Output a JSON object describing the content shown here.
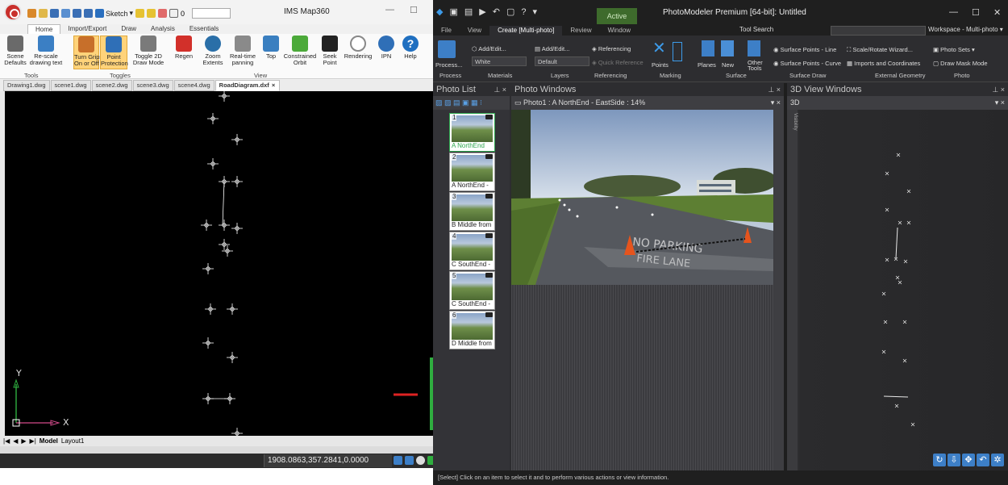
{
  "ims": {
    "title": "IMS Map360",
    "quick_access": {
      "workspace_label": "Sketch",
      "layer_value": "0"
    },
    "ribbon_tabs": [
      "Home",
      "Import/Export",
      "Draw",
      "Analysis",
      "Essentials"
    ],
    "active_tab": "Home",
    "ribbon_buttons": [
      {
        "label": "Scene\nDefaults",
        "group": "Tools"
      },
      {
        "label": "Re-scale\ndrawing text",
        "group": "Tools"
      },
      {
        "label": "Turn Grips\nOn or Off",
        "group": "Toggles",
        "highlighted": true
      },
      {
        "label": "Point\nProtection",
        "group": "Toggles",
        "highlighted": true
      },
      {
        "label": "Toggle 2D\nDraw Mode",
        "group": "Toggles"
      },
      {
        "label": "Regen",
        "group": "View"
      },
      {
        "label": "Zoom\nExtents",
        "group": "View"
      },
      {
        "label": "Real-time\npanning",
        "group": "View"
      },
      {
        "label": "Top",
        "group": "View"
      },
      {
        "label": "Constrained\nOrbit",
        "group": "View"
      },
      {
        "label": "Seek\nPoint",
        "group": "View"
      },
      {
        "label": "Rendering",
        "group": ""
      },
      {
        "label": "IPN",
        "group": ""
      },
      {
        "label": "Help",
        "group": ""
      }
    ],
    "ribbon_groups": [
      "Tools",
      "Toggles",
      "View"
    ],
    "doc_tabs": [
      "Drawing1.dwg",
      "scene1.dwg",
      "scene2.dwg",
      "scene3.dwg",
      "scene4.dwg",
      "RoadDiagram.dxf"
    ],
    "active_doc": "RoadDiagram.dxf",
    "layout_tabs": [
      "Model",
      "Layout1"
    ],
    "coordinates": "1908.0863,357.2841,0.0000",
    "axis_labels": {
      "y": "Y",
      "x": "X"
    },
    "colors": {
      "canvas": "#000000",
      "accent": "#c9302c",
      "axis": "#2fae3f"
    }
  },
  "pm": {
    "title": "PhotoModeler Premium [64-bit]: Untitled",
    "active_badge": "Active",
    "tabs": [
      "File",
      "View",
      "Create [Multi-photo]",
      "Review",
      "Window"
    ],
    "active_tab": "Create [Multi-photo]",
    "tool_search_label": "Tool Search",
    "workspace_label": "Workspace - Multi-photo",
    "ribbon": {
      "process": "Process...",
      "materials_add": "Add/Edit...",
      "materials_value": "White",
      "layers_add": "Add/Edit...",
      "layers_value": "Default",
      "referencing": "Referencing",
      "quick_reference": "Quick Reference",
      "points": "Points",
      "planes": "Planes",
      "new": "New",
      "other_tools": "Other\nTools",
      "surface_line": "Surface Points - Line",
      "surface_curve": "Surface Points - Curve",
      "scale_rotate": "Scale/Rotate Wizard...",
      "imports_coords": "Imports and Coordinates",
      "photo_sets": "Photo Sets",
      "draw_mask": "Draw Mask Mode"
    },
    "ribbon_groups": [
      "Process",
      "Materials",
      "Layers",
      "Referencing",
      "Marking",
      "Surface",
      "Surface Draw",
      "External Geometry",
      "Photo"
    ],
    "panes": {
      "photo_list": "Photo List",
      "photo_windows": "Photo Windows",
      "photo_tab": "Photo1 : A NorthEnd - EastSide : 14%",
      "view3d_windows": "3D View Windows",
      "view3d_tab": "3D",
      "visibility": "Visibility"
    },
    "photos": [
      {
        "num": "1",
        "label": "A NorthEnd",
        "selected": true
      },
      {
        "num": "2",
        "label": "A NorthEnd -"
      },
      {
        "num": "3",
        "label": "B Middle from"
      },
      {
        "num": "4",
        "label": "C SouthEnd -"
      },
      {
        "num": "5",
        "label": "C SouthEnd -"
      },
      {
        "num": "6",
        "label": "D Middle from"
      }
    ],
    "status": "[Select] Click on an item to select it and to perform various actions or view information.",
    "colors": {
      "bg": "#2d2d30",
      "active_badge": "#3e6b2c",
      "selected": "#2fa84f",
      "nav": "#3d7fc7"
    }
  }
}
